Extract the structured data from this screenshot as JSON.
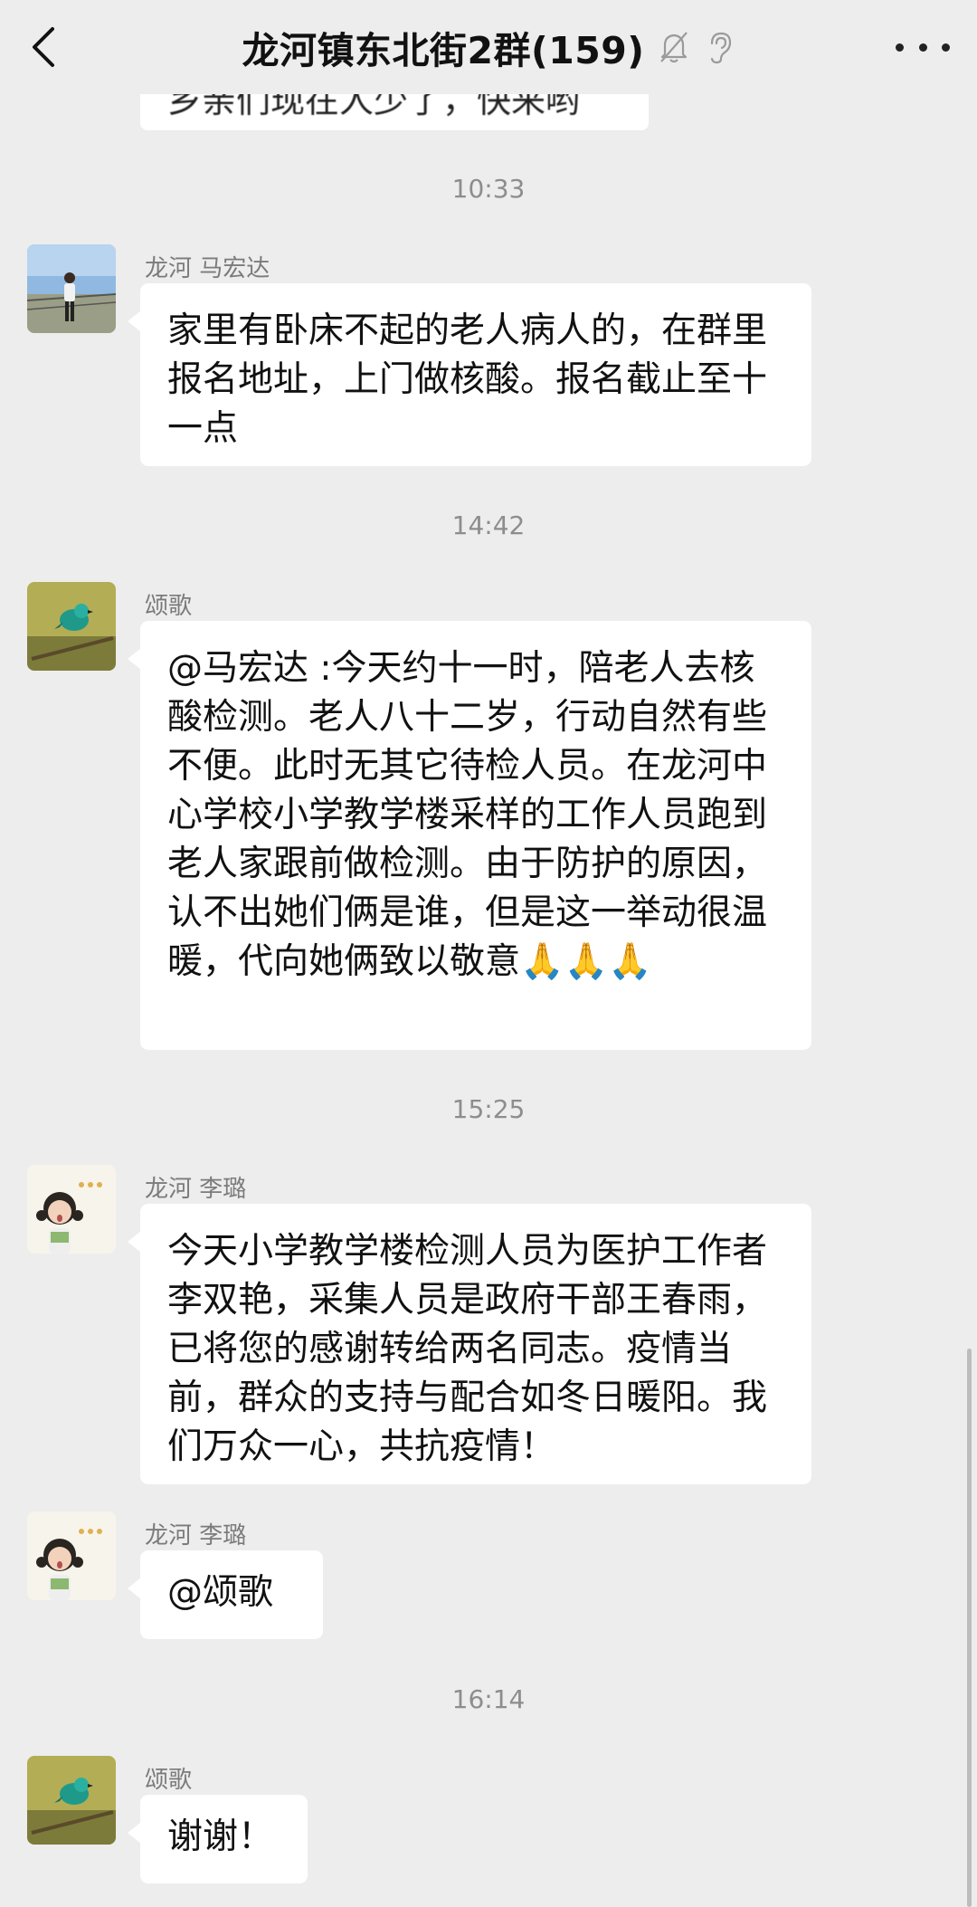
{
  "header": {
    "title": "龙河镇东北街2群(159)",
    "back_icon": "chevron-left-icon",
    "mute_icon": "bell-off-icon",
    "ear_icon": "ear-icon",
    "more_icon": "more-horizontal-icon"
  },
  "cut_off_message": "乡亲们现在人少了，快来哟",
  "timestamps": [
    "10:33",
    "14:42",
    "15:25",
    "16:14"
  ],
  "messages": [
    {
      "sender": "龙河 马宏达",
      "text": "家里有卧床不起的老人病人的，在群里报名地址，上门做核酸。报名截止至十一点"
    },
    {
      "sender": "颂歌",
      "text": "@马宏达 :今天约十一时，陪老人去核酸检测。老人八十二岁，行动自然有些不便。此时无其它待检人员。在龙河中心学校小学教学楼采样的工作人员跑到老人家跟前做检测。由于防护的原因，认不出她们俩是谁，但是这一举动很温暖，代向她俩致以敬意🙏🙏🙏"
    },
    {
      "sender": "龙河 李璐",
      "text": "今天小学教学楼检测人员为医护工作者李双艳，采集人员是政府干部王春雨，已将您的感谢转给两名同志。疫情当前，群众的支持与配合如冬日暖阳。我们万众一心，共抗疫情！"
    },
    {
      "sender": "龙河 李璐",
      "text": "@颂歌"
    },
    {
      "sender": "颂歌",
      "text": "谢谢！"
    }
  ],
  "colors": {
    "background": "#ededed",
    "bubble": "#ffffff",
    "timestamp": "#8d8d8d",
    "name": "#7b7b7b"
  }
}
